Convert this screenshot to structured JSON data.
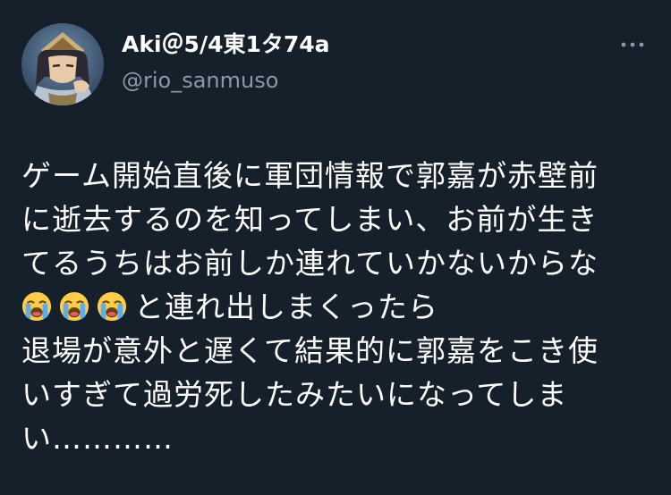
{
  "tweet": {
    "author": {
      "display_name": "Aki＠5/4東1タ74a",
      "handle": "@rio_sanmuso"
    },
    "more_icon": "more-horizontal-icon",
    "emoji": "loudly-crying-face",
    "text_lines": {
      "l1": "ゲーム開始直後に軍団情報で郭嘉が赤壁前",
      "l2": "に逝去するのを知ってしまい、お前が生き",
      "l3": "てるうちはお前しか連れていかないからな",
      "l4": "と連れ出しまくったら",
      "l5": "退場が意外と遅くて結果的に郭嘉をこき使",
      "l6": "いすぎて過労死したみたいになってしま",
      "l7": "い…………"
    }
  },
  "colors": {
    "background": "#15202b",
    "text": "#ffffff",
    "secondary": "#8b98a5"
  }
}
